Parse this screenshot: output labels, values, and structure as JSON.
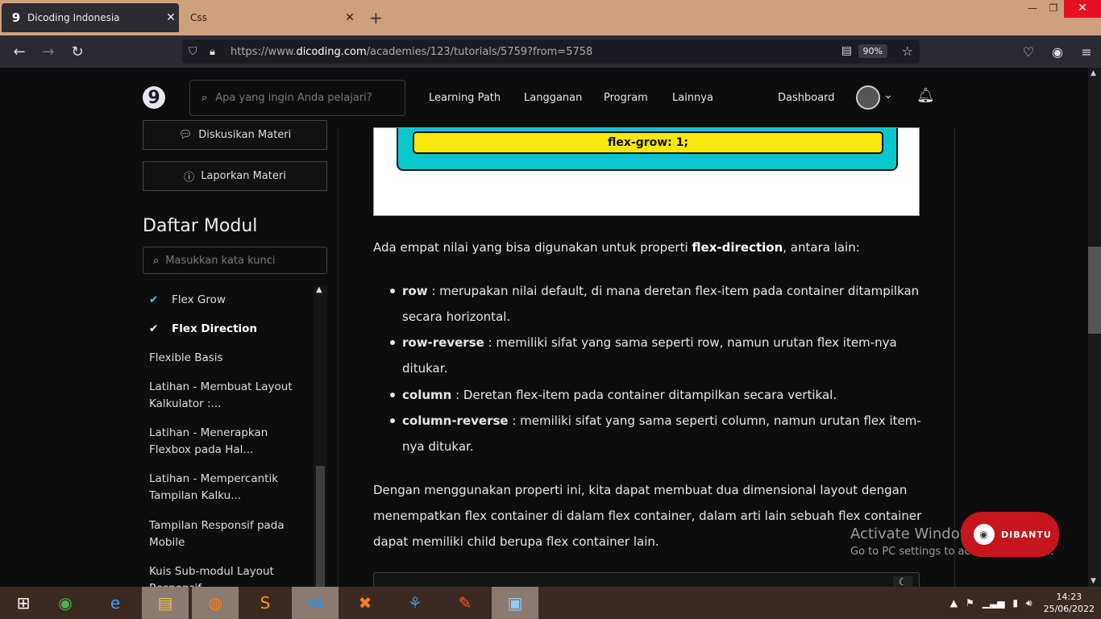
{
  "browser": {
    "tabs": [
      {
        "title": "Dicoding Indonesia",
        "favicon": "9",
        "close": "✕"
      },
      {
        "title": "Css",
        "close": "✕"
      }
    ],
    "new_tab": "+",
    "window_controls": {
      "minimize": "—",
      "maximize": "❐",
      "close": "✕"
    },
    "url_prefix": "https://www.",
    "url_domain": "dicoding.com",
    "url_path": "/academies/123/tutorials/5759?from=5758",
    "zoom": "90%"
  },
  "site": {
    "logo": "9",
    "search_placeholder": "Apa yang ingin Anda pelajari?",
    "menu": [
      "Learning Path",
      "Langganan",
      "Program",
      "Lainnya"
    ],
    "dashboard": "Dashboard"
  },
  "sidebar": {
    "discuss_button": "Diskusikan Materi",
    "report_button": "Laporkan Materi",
    "heading": "Daftar Modul",
    "search_placeholder": "Masukkan kata kunci",
    "items": [
      {
        "label": "Flex Grow",
        "checked": true
      },
      {
        "label": "Flex Direction",
        "checked": true,
        "current": true
      },
      {
        "label": "Flexible Basis"
      },
      {
        "label": "Latihan - Membuat Layout Kalkulator :..."
      },
      {
        "label": "Latihan - Menerapkan Flexbox pada Hal..."
      },
      {
        "label": "Latihan - Mempercantik Tampilan Kalku..."
      },
      {
        "label": "Tampilan Responsif pada Mobile"
      },
      {
        "label": "Kuis Sub-modul Layout Responsif"
      }
    ]
  },
  "content": {
    "diagram_label": "flex-grow: 1;",
    "intro_pre": "Ada empat nilai yang bisa digunakan untuk properti ",
    "intro_bold": "flex-direction",
    "intro_post": ", antara lain:",
    "list": [
      {
        "term": "row",
        "text": " : merupakan nilai default, di mana deretan flex-item pada container ditampilkan secara horizontal."
      },
      {
        "term": "row-reverse",
        "text": " : memiliki sifat yang sama seperti row, namun urutan flex item-nya ditukar."
      },
      {
        "term": "column",
        "text": " : Deretan flex-item pada container ditampilkan secara vertikal."
      },
      {
        "term": "column-reverse",
        "text": " : memiliki sifat yang sama seperti column, namun urutan flex item-nya ditukar."
      }
    ],
    "paragraph2": "Dengan menggunakan properti ini, kita dapat membuat dua dimensional layout dengan menempatkan flex container di dalam flex container, dalam arti lain sebuah flex container dapat memiliki child berupa flex container lain."
  },
  "overlay": {
    "activate_title": "Activate Windows",
    "activate_sub": "Go to PC settings to activate Windows.",
    "dibantu": "DIBANTU"
  },
  "taskbar": {
    "time": "14:23",
    "date": "25/06/2022"
  },
  "colors": {
    "accent_check": "#3fd4f0",
    "diagram_cyan": "#08c7cc",
    "diagram_yellow": "#f6e80c",
    "dibantu_red": "#c4161c"
  }
}
